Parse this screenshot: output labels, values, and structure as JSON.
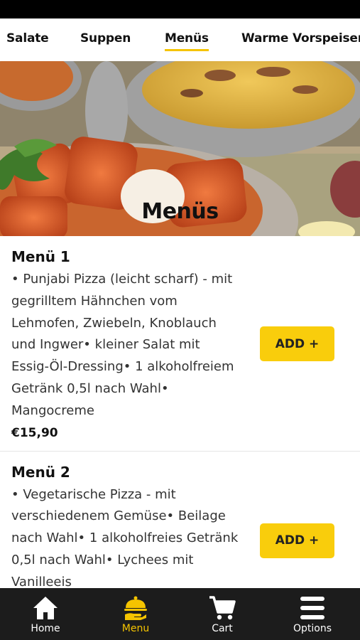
{
  "categories": [
    {
      "label": "Salate",
      "active": false
    },
    {
      "label": "Suppen",
      "active": false
    },
    {
      "label": "Menüs",
      "active": true
    },
    {
      "label": "Warme Vorspeisen",
      "active": false
    }
  ],
  "hero": {
    "title": "Menüs"
  },
  "items": [
    {
      "title": "Menü 1",
      "description": "• Punjabi Pizza (leicht scharf) - mit gegrilltem Hähnchen vom Lehmofen, Zwiebeln, Knoblauch und Ingwer• kleiner Salat mit Essig-Öl-Dressing• 1 alkoholfreiem Getränk 0,5l nach Wahl• Mangocreme",
      "price": "€15,90",
      "add_label": "ADD +"
    },
    {
      "title": "Menü 2",
      "description": "• Vegetarische Pizza - mit verschiedenem Gemüse• Beilage nach Wahl• 1 alkoholfreies Getränk 0,5l nach Wahl• Lychees mit Vanilleeis",
      "price": "",
      "add_label": "ADD +"
    }
  ],
  "bottom_nav": [
    {
      "label": "Home",
      "icon": "home-icon",
      "active": false
    },
    {
      "label": "Menu",
      "icon": "serving-dish-icon",
      "active": true
    },
    {
      "label": "Cart",
      "icon": "cart-icon",
      "active": false
    },
    {
      "label": "Options",
      "icon": "hamburger-menu-icon",
      "active": false
    }
  ],
  "colors": {
    "accent": "#f5c400",
    "button": "#f9cd0c",
    "nav_bg": "#1c1c1c",
    "status_bar": "#000000"
  }
}
